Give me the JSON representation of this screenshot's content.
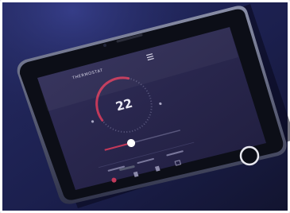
{
  "photo": {
    "subject": "smartphone-on-dark-surface",
    "colors": {
      "background": "#1a1f4a",
      "phone_body": "#0d0f18",
      "screen": "#2a2850",
      "accent": "#c2395a",
      "gauge_track": "#5a587e",
      "text": "#e8e6f2"
    }
  },
  "app": {
    "header_title": "THERMOSTAT",
    "temperature": "22",
    "gauge_level": 0.62,
    "slider_level": 0.35,
    "tabs": [
      "",
      "",
      ""
    ]
  },
  "icons": {
    "menu": "menu-icon",
    "home_button": "home-button",
    "power": "power-icon"
  }
}
